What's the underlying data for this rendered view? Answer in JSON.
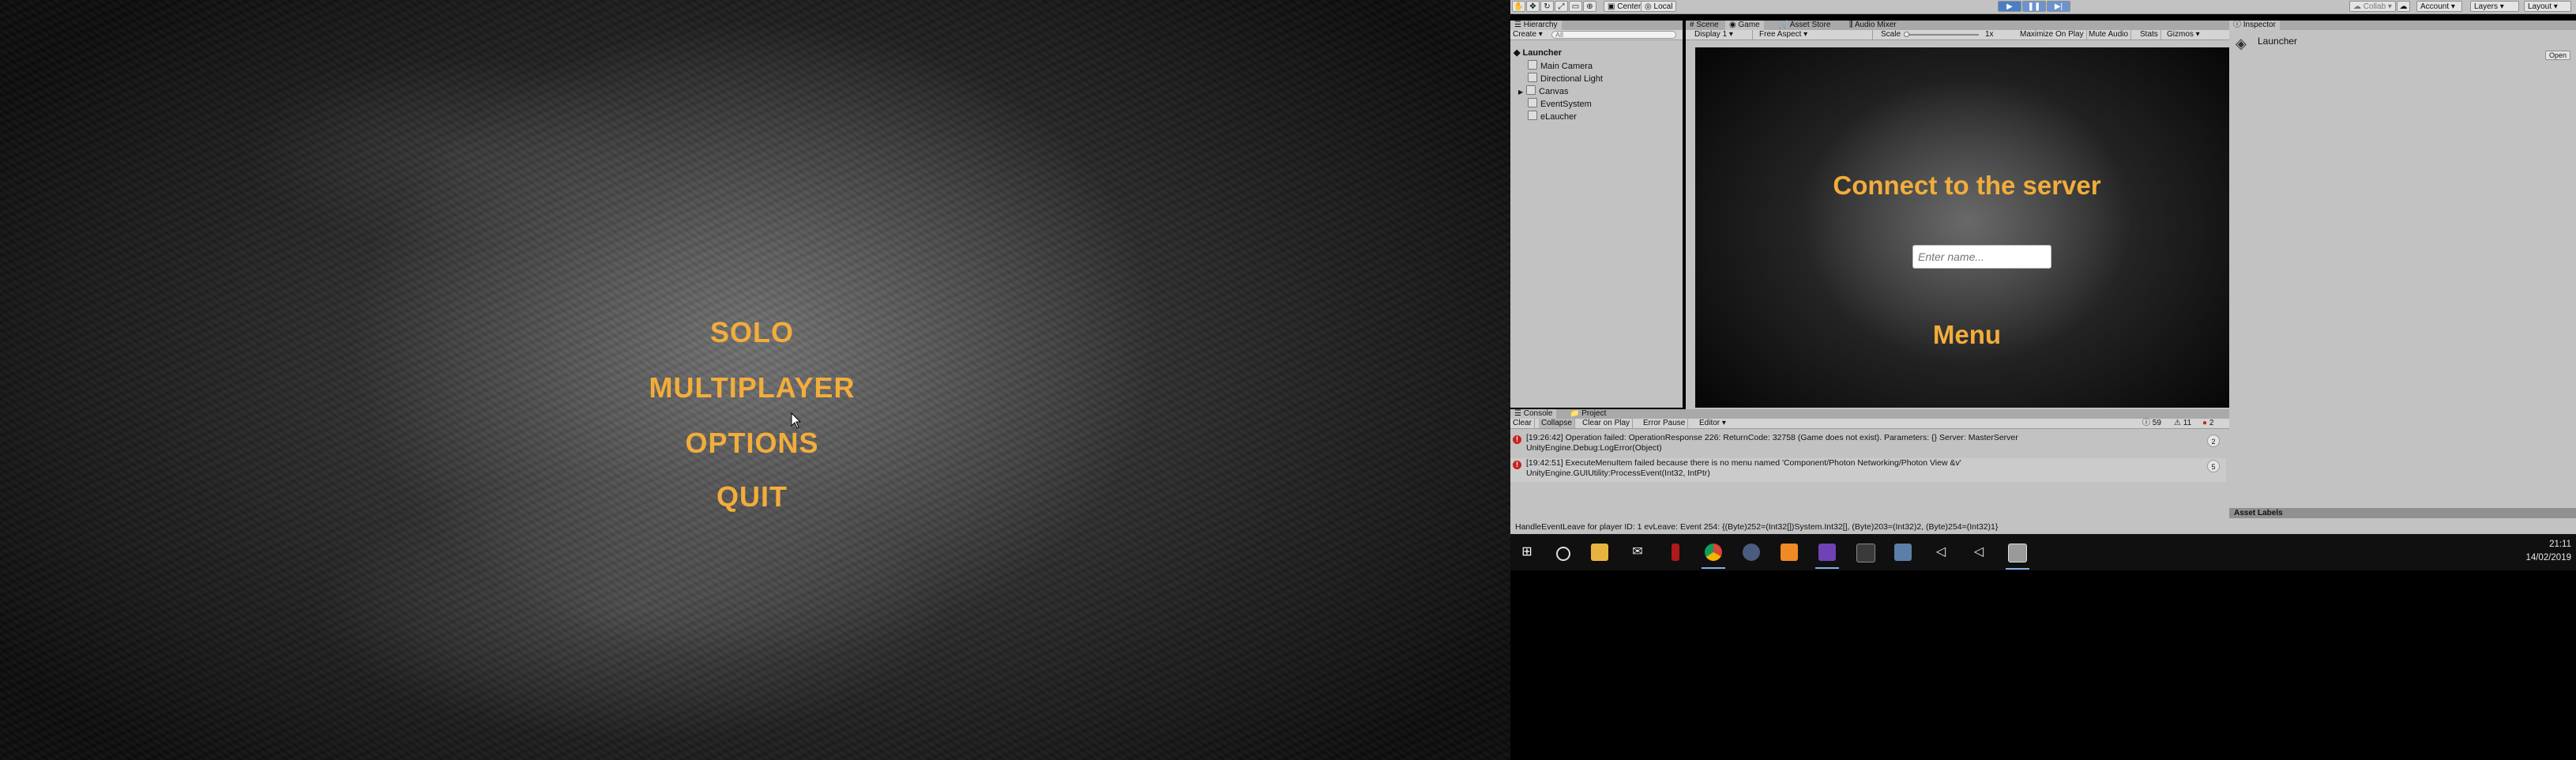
{
  "game": {
    "menu": [
      "SOLO",
      "MULTIPLAYER",
      "OPTIONS",
      "QUIT"
    ]
  },
  "toolbar": {
    "pivot": "Center",
    "space": "Local",
    "collab": "Collab",
    "account": "Account",
    "layers": "Layers",
    "layout": "Layout"
  },
  "hierarchy": {
    "tab": "Hierarchy",
    "create": "Create",
    "search_placeholder": "All",
    "scene": "Launcher",
    "items": [
      "Main Camera",
      "Directional Light",
      "Canvas",
      "EventSystem",
      "eLaucher"
    ]
  },
  "game_panel": {
    "tabs": [
      "Scene",
      "Game",
      "Asset Store",
      "Audio Mixer"
    ],
    "display": "Display 1",
    "aspect": "Free Aspect",
    "scale_label": "Scale",
    "scale_value": "1x",
    "options": [
      "Maximize On Play",
      "Mute Audio",
      "Stats",
      "Gizmos"
    ],
    "title": "Connect to the server",
    "input_placeholder": "Enter name...",
    "menu_label": "Menu"
  },
  "inspector": {
    "tab": "Inspector",
    "object": "Launcher",
    "open_button": "Open",
    "asset_labels": "Asset Labels"
  },
  "console": {
    "tabs": [
      "Console",
      "Project"
    ],
    "toolbar": [
      "Clear",
      "Collapse",
      "Clear on Play",
      "Error Pause",
      "Editor"
    ],
    "counts": {
      "log": "59",
      "warn": "11",
      "error": "2"
    },
    "entries": [
      {
        "line1": "[19:26:42] Operation failed: OperationResponse 226: ReturnCode: 32758 (Game does not exist). Parameters: {} Server: MasterServer",
        "line2": "UnityEngine.Debug:LogError(Object)",
        "count": "2"
      },
      {
        "line1": "[19:42:51] ExecuteMenuItem failed because there is no menu named 'Component/Photon Networking/Photon View &v'",
        "line2": "UnityEngine.GUIUtility:ProcessEvent(Int32, IntPtr)",
        "count": "5"
      }
    ],
    "status": "HandleEventLeave for player ID: 1 evLeave: Event 254: {(Byte)252=(Int32[])System.Int32[], (Byte)203=(Int32)2, (Byte)254=(Int32)1}"
  },
  "taskbar": {
    "time": "21:11",
    "date": "14/02/2019",
    "icons": [
      "windows-icon",
      "cortana-icon",
      "file-explorer-icon",
      "mail-icon",
      "app-red-icon",
      "chrome-icon",
      "steam-icon",
      "sublime-icon",
      "visual-studio-icon",
      "app-icon",
      "app-window-icon",
      "unity-icon",
      "unity-icon-2",
      "unity-editor-icon"
    ]
  }
}
